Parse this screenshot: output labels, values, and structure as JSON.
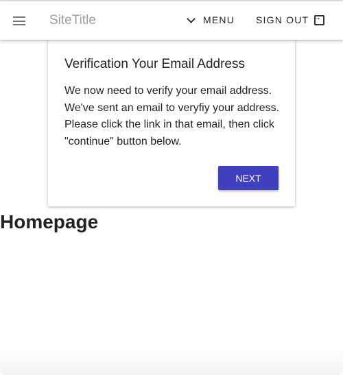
{
  "header": {
    "site_title": "SiteTitle",
    "menu_label": "MENU",
    "sign_out_label": "SIGN OUT"
  },
  "dialog": {
    "title": "Verification Your Email Address",
    "body": "We now need to verify your email address. We've sent an email to veryfiy your address. Please click the link in that email, then click \"continue\" button below.",
    "next_label": "NEXT"
  },
  "page": {
    "heading": "Homepage"
  },
  "colors": {
    "primary": "#4040bf"
  }
}
